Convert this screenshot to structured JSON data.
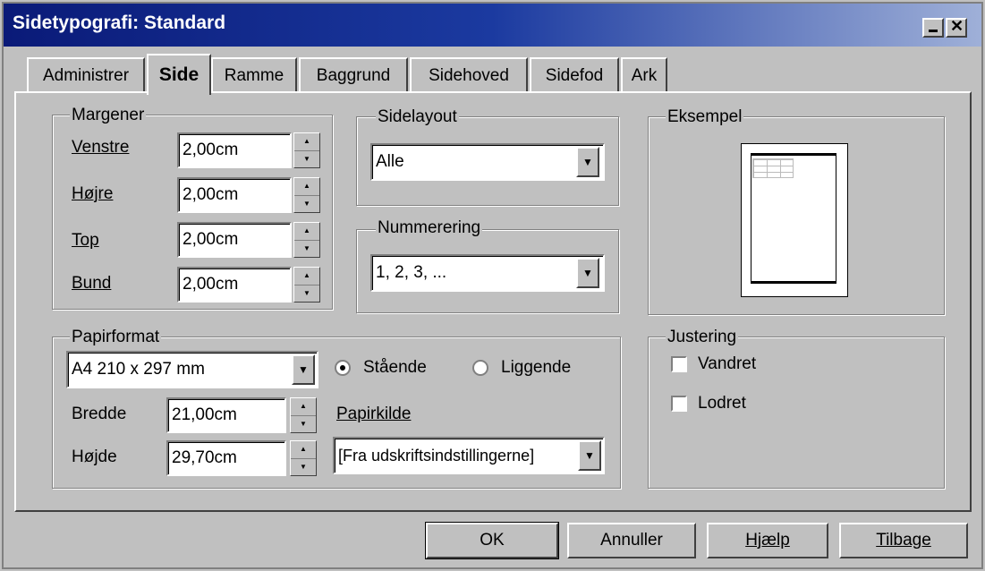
{
  "window": {
    "title": "Sidetypografi: Standard"
  },
  "tabs": [
    {
      "label": "Administrer"
    },
    {
      "label": "Side"
    },
    {
      "label": "Ramme"
    },
    {
      "label": "Baggrund"
    },
    {
      "label": "Sidehoved"
    },
    {
      "label": "Sidefod"
    },
    {
      "label": "Ark"
    }
  ],
  "margins": {
    "legend": "Margener",
    "left": {
      "label": "Venstre",
      "value": "2,00cm"
    },
    "right": {
      "label": "Højre",
      "value": "2,00cm"
    },
    "top": {
      "label": "Top",
      "value": "2,00cm"
    },
    "bottom": {
      "label": "Bund",
      "value": "2,00cm"
    }
  },
  "page_layout": {
    "legend": "Sidelayout",
    "selected": "Alle"
  },
  "numbering": {
    "legend": "Nummerering",
    "selected": "1, 2, 3, ..."
  },
  "example": {
    "legend": "Eksempel"
  },
  "paper": {
    "legend": "Papirformat",
    "format": "A4 210 x 297 mm",
    "width_label": "Bredde",
    "width_value": "21,00cm",
    "height_label": "Højde",
    "height_value": "29,70cm",
    "portrait": "Stående",
    "landscape": "Liggende",
    "orientation_selected": "portrait",
    "source_label": "Papirkilde",
    "source_value": "[Fra udskriftsindstillingerne]"
  },
  "alignment": {
    "legend": "Justering",
    "horizontal": "Vandret",
    "vertical": "Lodret"
  },
  "buttons": {
    "ok": "OK",
    "cancel": "Annuller",
    "help": "Hjælp",
    "reset": "Tilbage"
  }
}
